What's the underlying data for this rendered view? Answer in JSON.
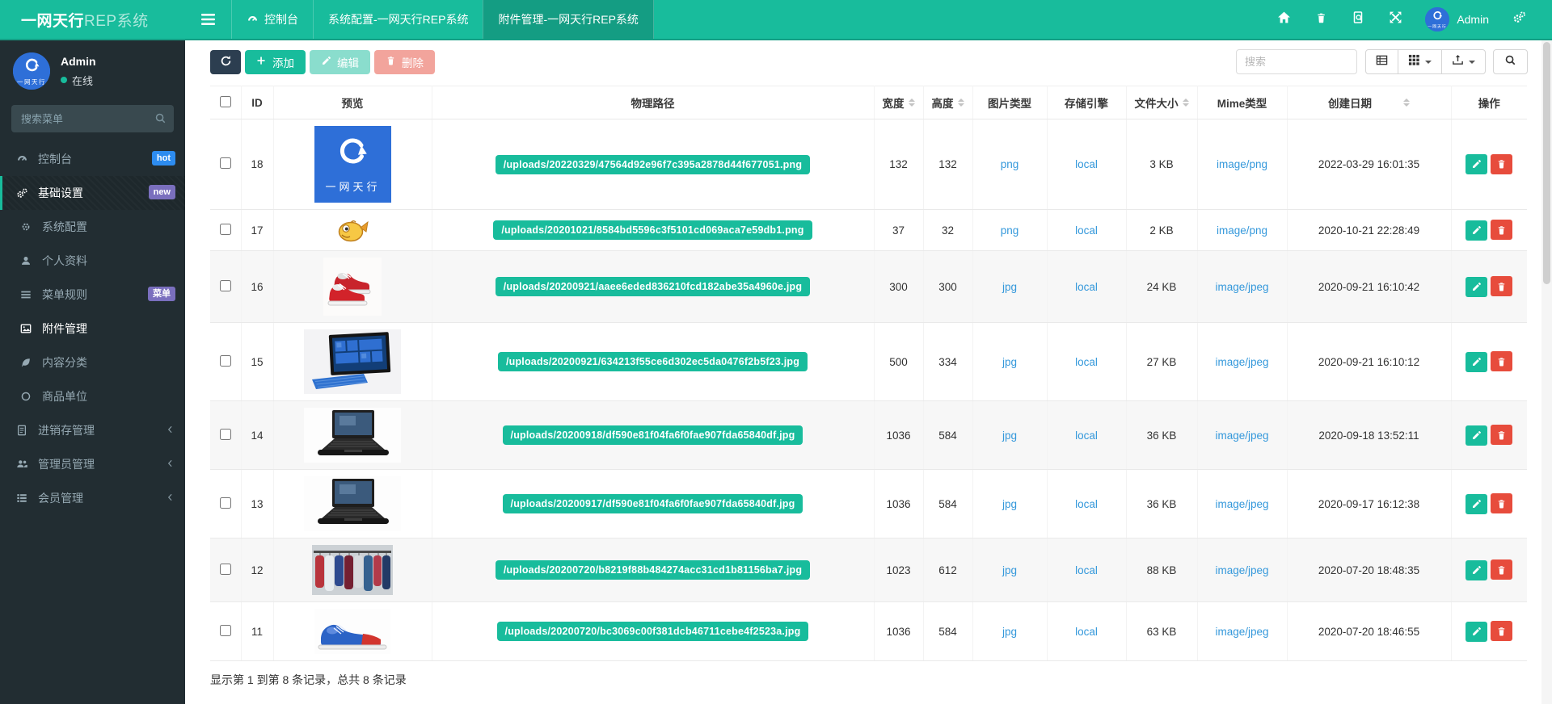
{
  "navbar": {
    "brand_bold": "一网天行",
    "brand_light": "REP系统",
    "tabs": [
      {
        "key": "dashboard",
        "label": "控制台",
        "icon": "gauge",
        "active": false
      },
      {
        "key": "system-config",
        "label": "系统配置-一网天行REP系统",
        "active": false
      },
      {
        "key": "attachments",
        "label": "附件管理-一网天行REP系统",
        "active": true
      }
    ],
    "user_name": "Admin",
    "right_icons": [
      "home",
      "trash",
      "doc-search",
      "expand",
      "gears"
    ]
  },
  "sidebar": {
    "user": {
      "name": "Admin",
      "status": "在线"
    },
    "search_placeholder": "搜索菜单",
    "menu": [
      {
        "key": "dashboard",
        "label": "控制台",
        "icon": "gauge",
        "badge": "hot",
        "badge_color": "#2d8cf0"
      },
      {
        "key": "basic-settings",
        "label": "基础设置",
        "icon": "gears",
        "badge": "new",
        "badge_color": "#7a6fbe",
        "active": true,
        "children": [
          {
            "key": "system-config",
            "label": "系统配置",
            "icon": "gear"
          },
          {
            "key": "profile",
            "label": "个人资料",
            "icon": "user"
          },
          {
            "key": "menu-rules",
            "label": "菜单规则",
            "icon": "bars",
            "badge": "菜单",
            "badge_color": "#7a6fbe"
          },
          {
            "key": "attachments",
            "label": "附件管理",
            "icon": "image",
            "current": true
          },
          {
            "key": "content-category",
            "label": "内容分类",
            "icon": "leaf"
          },
          {
            "key": "product-unit",
            "label": "商品单位",
            "icon": "circle"
          }
        ]
      },
      {
        "key": "inventory",
        "label": "进销存管理",
        "icon": "file-text",
        "chevron": true
      },
      {
        "key": "admin-manage",
        "label": "管理员管理",
        "icon": "users",
        "chevron": true
      },
      {
        "key": "member-manage",
        "label": "会员管理",
        "icon": "list",
        "chevron": true
      }
    ]
  },
  "toolbar": {
    "add_label": "添加",
    "edit_label": "编辑",
    "delete_label": "删除",
    "search_placeholder": "搜索"
  },
  "table": {
    "columns": [
      {
        "label": "ID"
      },
      {
        "label": "预览"
      },
      {
        "label": "物理路径"
      },
      {
        "label": "宽度",
        "sortable": true
      },
      {
        "label": "高度",
        "sortable": true
      },
      {
        "label": "图片类型"
      },
      {
        "label": "存储引擎"
      },
      {
        "label": "文件大小",
        "sortable": true
      },
      {
        "label": "Mime类型"
      },
      {
        "label": "创建日期",
        "sortable": true,
        "date": true
      },
      {
        "label": "操作"
      }
    ],
    "rows": [
      {
        "id": "18",
        "thumb": "logo",
        "path": "/uploads/20220329/47564d92e96f7c395a2878d44f677051.png",
        "width": "132",
        "height": "132",
        "type": "png",
        "storage": "local",
        "size": "3 KB",
        "mime": "image/png",
        "date": "2022-03-29 16:01:35"
      },
      {
        "id": "17",
        "thumb": "fish",
        "path": "/uploads/20201021/8584bd5596c3f5101cd069aca7e59db1.png",
        "width": "37",
        "height": "32",
        "type": "png",
        "storage": "local",
        "size": "2 KB",
        "mime": "image/png",
        "date": "2020-10-21 22:28:49"
      },
      {
        "id": "16",
        "thumb": "sneakers",
        "path": "/uploads/20200921/aaee6eded836210fcd182abe35a4960e.jpg",
        "width": "300",
        "height": "300",
        "type": "jpg",
        "storage": "local",
        "size": "24 KB",
        "mime": "image/jpeg",
        "date": "2020-09-21 16:10:42"
      },
      {
        "id": "15",
        "thumb": "surface",
        "path": "/uploads/20200921/634213f55ce6d302ec5da0476f2b5f23.jpg",
        "width": "500",
        "height": "334",
        "type": "jpg",
        "storage": "local",
        "size": "27 KB",
        "mime": "image/jpeg",
        "date": "2020-09-21 16:10:12"
      },
      {
        "id": "14",
        "thumb": "laptop",
        "path": "/uploads/20200918/df590e81f04fa6f0fae907fda65840df.jpg",
        "width": "1036",
        "height": "584",
        "type": "jpg",
        "storage": "local",
        "size": "36 KB",
        "mime": "image/jpeg",
        "date": "2020-09-18 13:52:11"
      },
      {
        "id": "13",
        "thumb": "laptop",
        "path": "/uploads/20200917/df590e81f04fa6f0fae907fda65840df.jpg",
        "width": "1036",
        "height": "584",
        "type": "jpg",
        "storage": "local",
        "size": "36 KB",
        "mime": "image/jpeg",
        "date": "2020-09-17 16:12:38"
      },
      {
        "id": "12",
        "thumb": "clothes",
        "path": "/uploads/20200720/b8219f88b484274acc31cd1b81156ba7.jpg",
        "width": "1023",
        "height": "612",
        "type": "jpg",
        "storage": "local",
        "size": "88 KB",
        "mime": "image/jpeg",
        "date": "2020-07-20 18:48:35"
      },
      {
        "id": "11",
        "thumb": "shoe",
        "path": "/uploads/20200720/bc3069c00f381dcb46711cebe4f2523a.jpg",
        "width": "1036",
        "height": "584",
        "type": "jpg",
        "storage": "local",
        "size": "63 KB",
        "mime": "image/jpeg",
        "date": "2020-07-20 18:46:55"
      }
    ]
  },
  "footer": {
    "info": "显示第 1 到第 8 条记录，总共 8 条记录"
  },
  "colors": {
    "accent": "#18bc9c",
    "navy": "#2c3e50",
    "danger": "#e74c3c",
    "link": "#3498db",
    "sidebar_bg": "#222d32"
  }
}
